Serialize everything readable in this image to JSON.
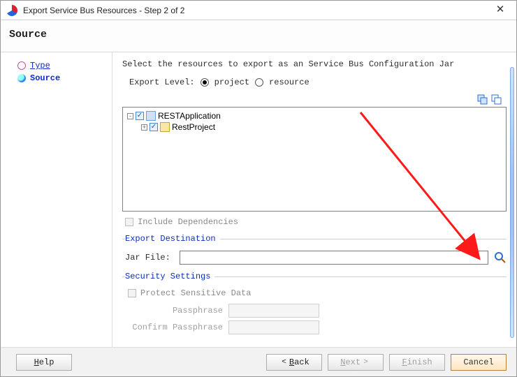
{
  "window": {
    "title": "Export Service Bus Resources - Step 2 of 2"
  },
  "header": {
    "title": "Source"
  },
  "sidebar": {
    "items": [
      {
        "label": "Type"
      },
      {
        "label": "Source"
      }
    ]
  },
  "main": {
    "desc": "Select the resources to export as an Service Bus Configuration Jar",
    "exportLevelLabel": "Export Level:",
    "radio": {
      "project": "project",
      "resource": "resource"
    },
    "tree": {
      "root": "RESTApplication",
      "child": "RestProject"
    },
    "includeDeps": "Include Dependencies",
    "destLegend": "Export Destination",
    "jarFileLabel": "Jar File:",
    "jarFileValue": "",
    "secLegend": "Security Settings",
    "protect": "Protect Sensitive Data",
    "passLabel": "Passphrase",
    "confirmLabel": "Confirm Passphrase"
  },
  "footer": {
    "help": "Help",
    "back": "Back",
    "next": "Next",
    "finish": "Finish",
    "cancel": "Cancel"
  }
}
